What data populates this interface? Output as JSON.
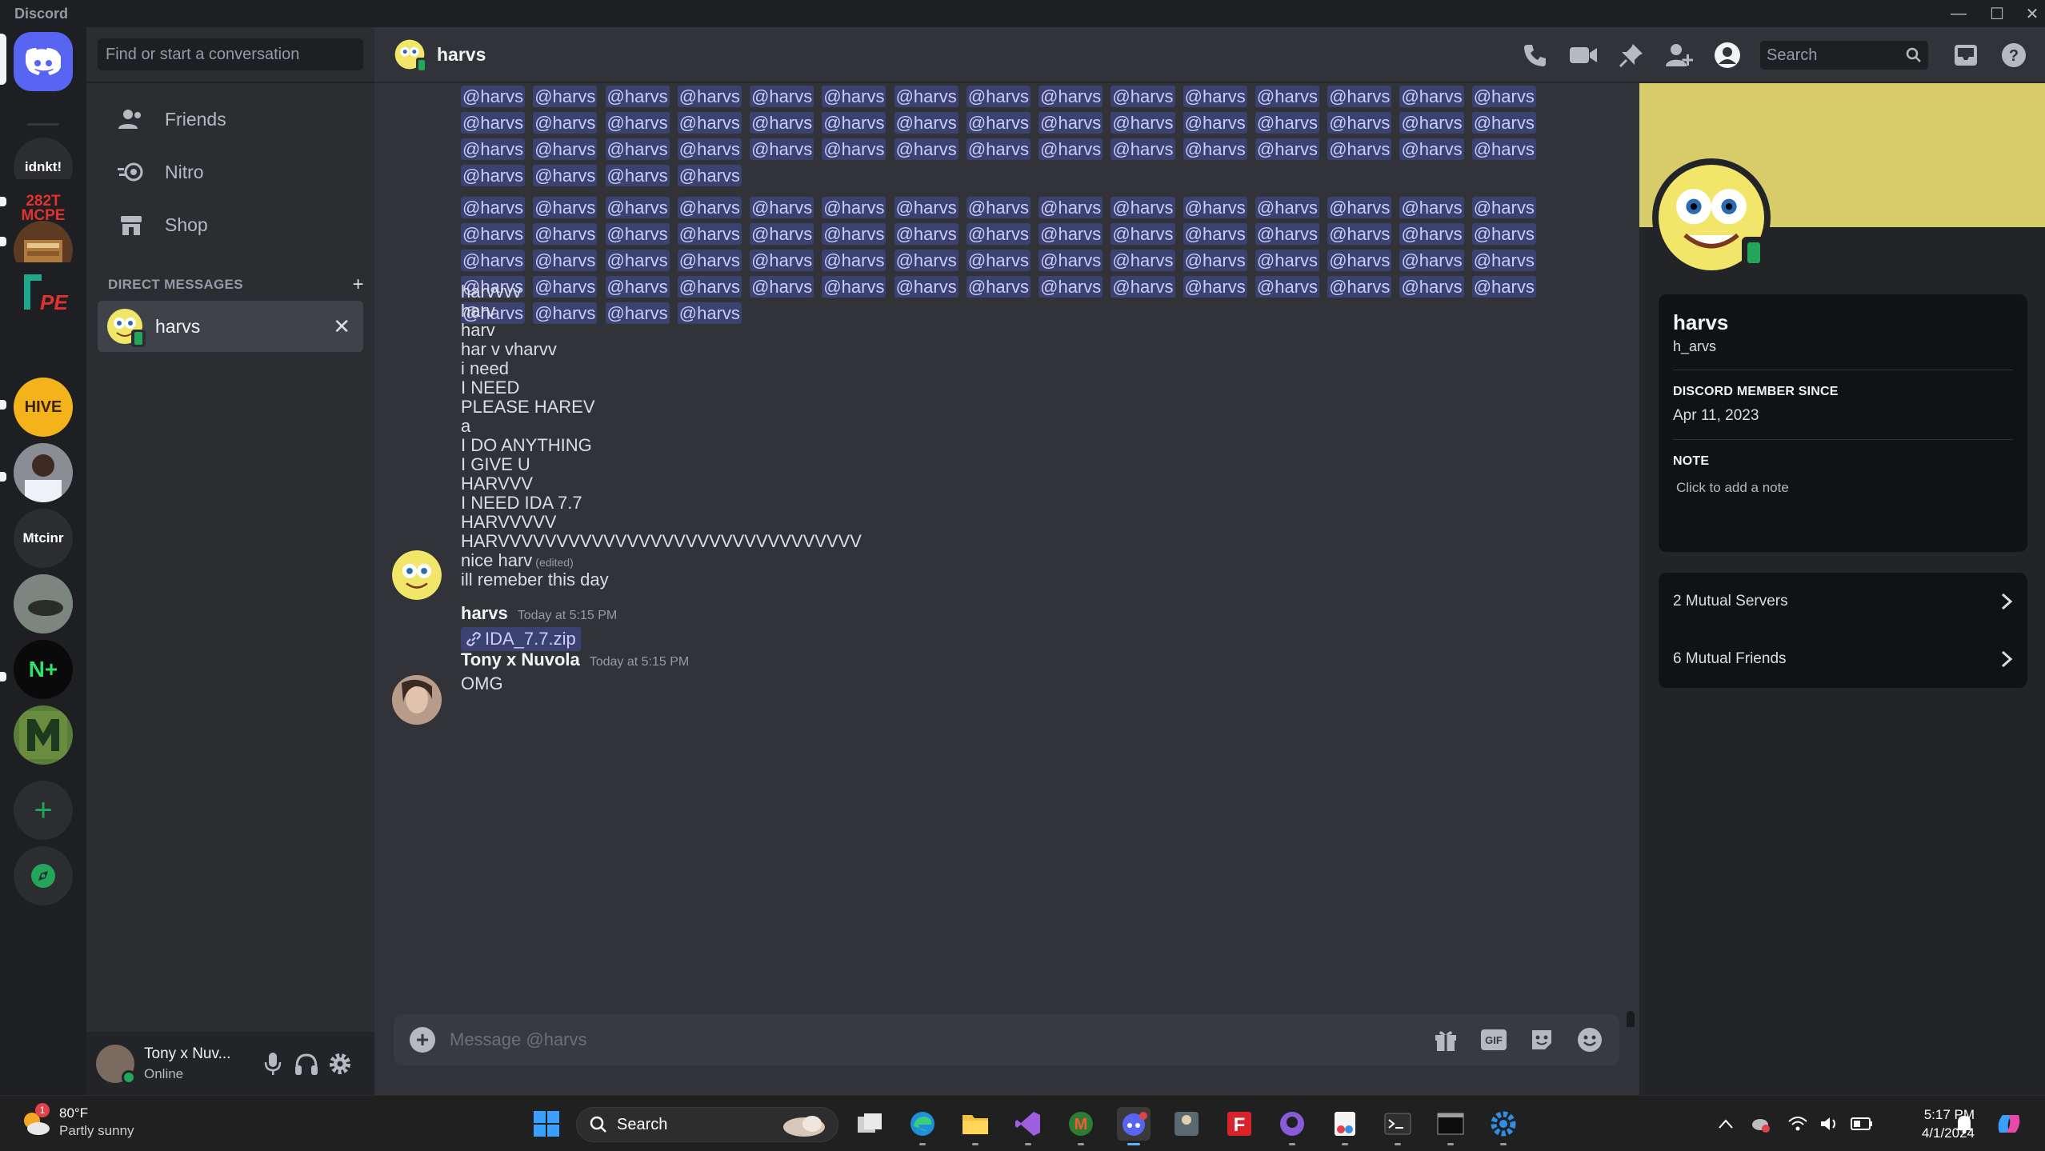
{
  "window": {
    "app_title": "Discord",
    "minimize": "—",
    "maximize": "☐",
    "close": "✕"
  },
  "rail": {
    "servers": [
      {
        "label": "idnkt!",
        "bg": "#2b2d31"
      },
      {
        "label": "282T MCPE",
        "bg": "#1e1f22"
      },
      {
        "label": "",
        "bg": "#5c3b22"
      },
      {
        "label": "PE",
        "bg": "#1e1f22"
      },
      {
        "label": "HIVE",
        "bg": "#f5b31b"
      },
      {
        "label": "",
        "bg": "#6b5a56"
      },
      {
        "label": "Mtcinr",
        "bg": "#2b2d31"
      },
      {
        "label": "",
        "bg": "#6f7570"
      },
      {
        "label": "N+",
        "bg": "#0a0a0a"
      },
      {
        "label": "",
        "bg": "#5b7d3a"
      }
    ]
  },
  "dm_sidebar": {
    "search_placeholder": "Find or start a conversation",
    "nav": [
      {
        "label": "Friends",
        "icon": "friends-icon"
      },
      {
        "label": "Nitro",
        "icon": "nitro-icon"
      },
      {
        "label": "Shop",
        "icon": "shop-icon"
      }
    ],
    "header": "DIRECT MESSAGES",
    "add": "+",
    "dm_name": "harvs",
    "close": "✕"
  },
  "user_panel": {
    "name": "Tony x Nuv...",
    "status": "Online"
  },
  "chat": {
    "header_name": "harvs",
    "search_placeholder": "Search",
    "mention": "@harvs",
    "mention_block_1_count": 49,
    "mention_block_2_count": 64,
    "lines": [
      "harvvvv",
      "harv",
      "harv",
      "har v vharvv",
      "i need",
      "I NEED",
      "PLEASE HAREV",
      "a",
      "I DO ANYTHING",
      "I GIVE U",
      "HARVVV",
      "I NEED IDA 7.7",
      "HARVVVVV",
      "HARVVVVVVVVVVVVVVVVVVVVVVVVVVVVVVV",
      "nice harv",
      "ill remeber this day"
    ],
    "edited_tag": "(edited)",
    "msg1": {
      "author": "harvs",
      "timestamp": "Today at 5:15 PM",
      "attachment": "IDA_7.7.zip"
    },
    "msg2": {
      "author": "Tony x Nuvola",
      "timestamp": "Today at 5:15 PM",
      "text": "OMG"
    },
    "composer_placeholder": "Message @harvs",
    "gif_label": "GIF"
  },
  "profile": {
    "name": "harvs",
    "username": "h_arvs",
    "member_since_label": "DISCORD MEMBER SINCE",
    "member_since": "Apr 11, 2023",
    "note_label": "NOTE",
    "note_placeholder": "Click to add a note",
    "mutual_servers": "2 Mutual Servers",
    "mutual_friends": "6 Mutual Friends",
    "banner_color": "#d8cc6a"
  },
  "taskbar": {
    "temp": "80°F",
    "condition": "Partly sunny",
    "weather_badge": "1",
    "search": "Search",
    "time": "5:17 PM",
    "date": "4/1/2024"
  },
  "colors": {
    "blurple": "#5865f2",
    "green": "#23a55a",
    "mention_bg": "#3c4270"
  }
}
